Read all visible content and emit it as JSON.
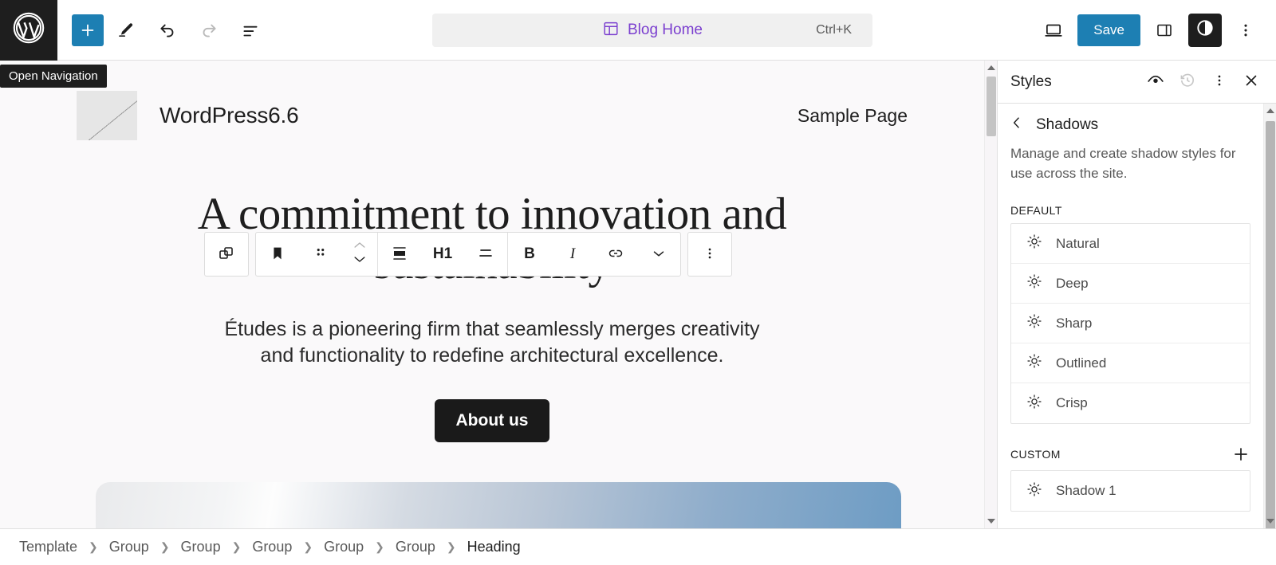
{
  "topbar": {
    "logo_icon": "wordpress-logo-icon",
    "logo_tooltip": "Open Navigation",
    "add_block_label": "+",
    "tools": [
      {
        "name": "toggle-block-inserter",
        "icon": "plus-icon"
      },
      {
        "name": "edit-mode-button",
        "icon": "pencil-icon"
      },
      {
        "name": "undo-button",
        "icon": "undo-arrow-icon"
      },
      {
        "name": "redo-button",
        "icon": "redo-arrow-icon"
      },
      {
        "name": "document-overview-button",
        "icon": "list-view-icon"
      }
    ],
    "command_bar": {
      "icon": "template-layout-icon",
      "label": "Blog Home",
      "shortcut": "Ctrl+K"
    },
    "view_icon": "desktop-preview-icon",
    "save_label": "Save",
    "settings_icon": "settings-sidebar-icon",
    "styles_icon": "styles-contrast-icon",
    "more_icon": "more-options-icon"
  },
  "block_toolbar": {
    "parent_icon": "select-parent-block-icon",
    "block_type_icon": "heading-block-icon",
    "drag_icon": "drag-handle-icon",
    "move_up_icon": "move-up-icon",
    "move_down_icon": "move-down-icon",
    "align_icon": "block-align-icon",
    "heading_level": "H1",
    "text_align_icon": "text-align-icon",
    "bold_label": "B",
    "italic_label": "I",
    "link_icon": "link-icon",
    "more_format_icon": "chevron-down-icon",
    "options_icon": "block-options-icon"
  },
  "canvas": {
    "site_logo_icon": "site-logo-placeholder",
    "site_title": "WordPress6.6",
    "nav_item": "Sample Page",
    "heading": "A commitment to innovation and sustainability",
    "paragraph": "Études is a pioneering firm that seamlessly merges creativity and functionality to redefine architectural excellence.",
    "button_label": "About us"
  },
  "sidebar": {
    "title": "Styles",
    "header_actions": [
      {
        "name": "style-book-button",
        "icon": "eye-icon"
      },
      {
        "name": "revisions-button",
        "icon": "history-clock-icon"
      },
      {
        "name": "styles-more-button",
        "icon": "more-options-icon"
      },
      {
        "name": "close-styles-button",
        "icon": "close-x-icon"
      }
    ],
    "back_icon": "chevron-left-icon",
    "panel_title": "Shadows",
    "description": "Manage and create shadow styles for use across the site.",
    "default_label": "DEFAULT",
    "default_shadows": [
      {
        "label": "Natural",
        "icon": "shadow-preset-icon"
      },
      {
        "label": "Deep",
        "icon": "shadow-preset-icon"
      },
      {
        "label": "Sharp",
        "icon": "shadow-preset-icon"
      },
      {
        "label": "Outlined",
        "icon": "shadow-preset-icon"
      },
      {
        "label": "Crisp",
        "icon": "shadow-preset-icon"
      }
    ],
    "custom_label": "CUSTOM",
    "add_custom_icon": "plus-icon",
    "custom_shadows": [
      {
        "label": "Shadow 1",
        "icon": "shadow-preset-icon"
      }
    ]
  },
  "breadcrumb": {
    "separator": "❯",
    "items": [
      "Template",
      "Group",
      "Group",
      "Group",
      "Group",
      "Group",
      "Heading"
    ]
  },
  "colors": {
    "accent_blue": "#1d7fb3",
    "command_purple": "#7b3fcf",
    "dark": "#1e1e1e"
  }
}
